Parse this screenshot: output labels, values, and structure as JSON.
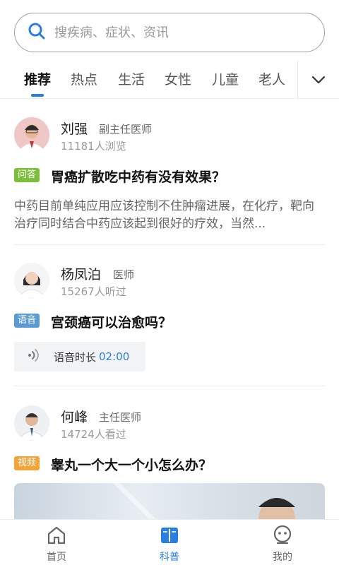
{
  "search": {
    "placeholder": "搜疾病、症状、资讯"
  },
  "tabs": [
    {
      "label": "推荐",
      "active": true
    },
    {
      "label": "热点"
    },
    {
      "label": "生活"
    },
    {
      "label": "女性"
    },
    {
      "label": "儿童"
    },
    {
      "label": "老人"
    }
  ],
  "feed": [
    {
      "doctor_name": "刘强",
      "doctor_title": "副主任医师",
      "count": "11181人浏览",
      "badge": "问答",
      "badge_color": "#7cbf3a",
      "question": "胃癌扩散吃中药有没有效果？",
      "excerpt": "中药目前单纯应用应该控制不住肿瘤进展，在化疗，靶向治疗同时结合中药应该起到很好的疗效，当然..."
    },
    {
      "doctor_name": "杨凤泊",
      "doctor_title": "医师",
      "count": "15267人听过",
      "badge": "语音",
      "badge_color": "#5b9bd5",
      "question": "宫颈癌可以治愈吗？",
      "voice_label": "语音时长",
      "voice_duration": "02:00"
    },
    {
      "doctor_name": "何峰",
      "doctor_title": "主任医师",
      "count": "14724人看过",
      "badge": "视频",
      "badge_color": "#f0a43a",
      "question": "睾丸一个大一个小怎么办？"
    }
  ],
  "bottom_nav": [
    {
      "label": "首页",
      "icon": "home-icon"
    },
    {
      "label": "科普",
      "icon": "book-icon",
      "active": true
    },
    {
      "label": "我的",
      "icon": "user-face-icon"
    }
  ],
  "colors": {
    "accent": "#2a7de1"
  }
}
